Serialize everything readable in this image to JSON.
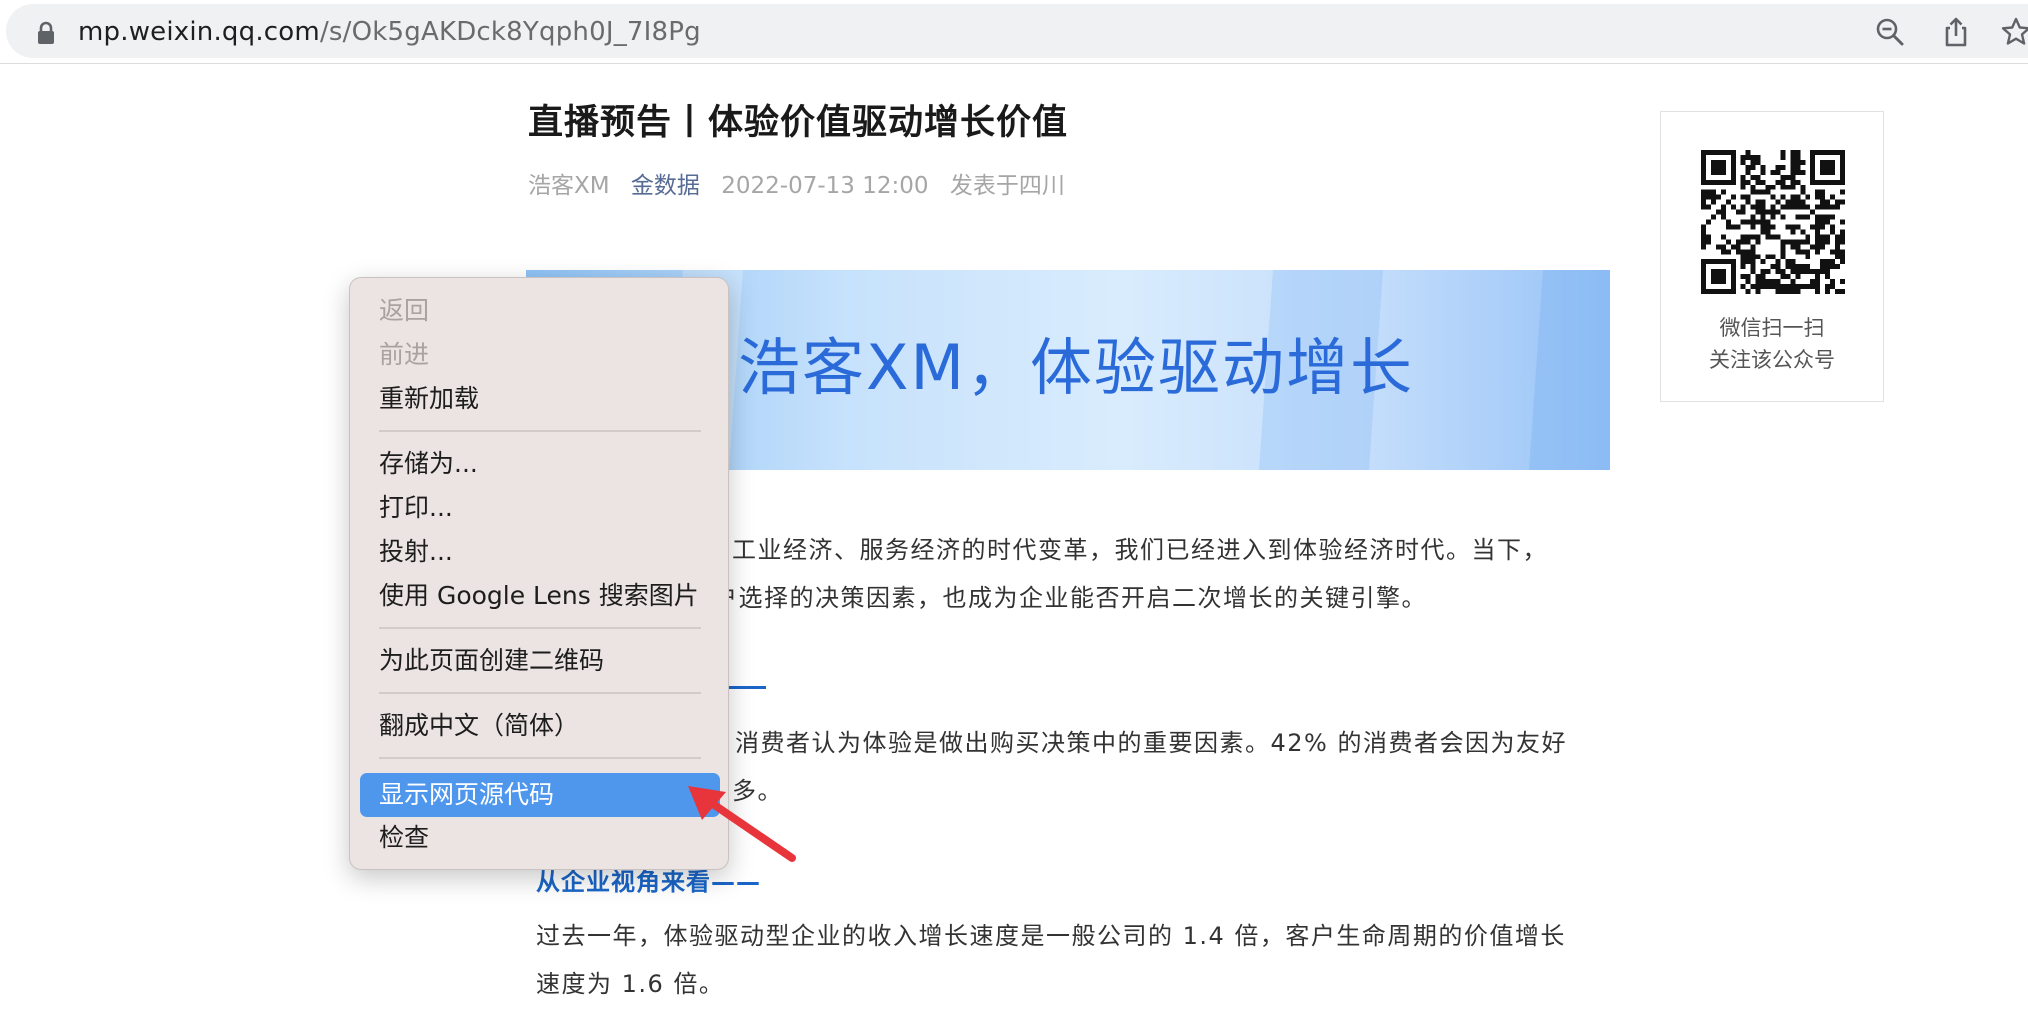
{
  "browser": {
    "url_host": "mp.weixin.qq.com",
    "url_path": "/s/Ok5gAKDck8Yqph0J_7I8Pg",
    "icons": [
      "lock-icon",
      "zoom-out-icon",
      "share-icon",
      "bookmark-star-icon"
    ]
  },
  "article": {
    "title": "直播预告丨体验价值驱动增长价值",
    "author": "浩客XM",
    "account": "金数据",
    "datetime": "2022-07-13 12:00",
    "location": "发表于四川",
    "banner_text": "浩客XM，体验驱动增长",
    "para1_line1": "工业经济、服务经济的时代变革，我们已经进入到体验经济时代。当下，",
    "para1_line2": "户选择的决策因素，也成为企业能否开启二次增长的关键引擎。",
    "para2_line1": "消费者认为体验是做出购买决策中的重要因素。42% 的消费者会因为友好",
    "para2_line2": "多。",
    "section2_heading": "从企业视角来看——",
    "para3_line1": "过去一年，体验驱动型企业的收入增长速度是一般公司的 1.4 倍，客户生命周期的价值增长",
    "para3_line2": "速度为 1.6 倍。"
  },
  "qr": {
    "caption_line1": "微信扫一扫",
    "caption_line2": "关注该公众号"
  },
  "context_menu": {
    "back": "返回",
    "forward": "前进",
    "reload": "重新加载",
    "save_as": "存储为...",
    "print": "打印...",
    "cast": "投射...",
    "lens": "使用 Google Lens 搜索图片",
    "create_qr": "为此页面创建二维码",
    "translate": "翻成中文（简体）",
    "view_source": "显示网页源代码",
    "inspect": "检查",
    "disabled_items": [
      "back",
      "forward"
    ],
    "highlighted_item": "view_source"
  },
  "colors": {
    "menu_highlight": "#4e97ed",
    "link_blue": "#576b95",
    "heading_blue": "#1a66c8",
    "arrow_red": "#e8343b"
  }
}
